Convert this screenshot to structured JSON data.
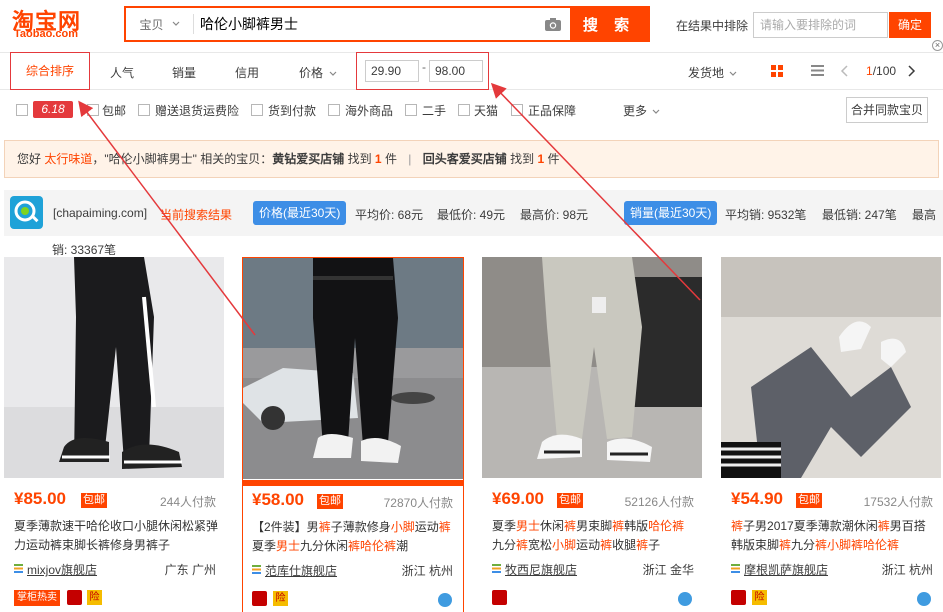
{
  "header": {
    "logo_cn": "淘宝网",
    "logo_en": "Taobao.com",
    "search_category": "宝贝",
    "search_query": "哈伦小脚裤男士",
    "search_button": "搜 索",
    "exclude_label": "在结果中排除",
    "exclude_placeholder": "请输入要排除的词",
    "exclude_confirm": "确定",
    "accent_color": "#ff4400"
  },
  "sortbar": {
    "tabs": [
      "综合排序",
      "人气",
      "销量",
      "信用",
      "价格"
    ],
    "active_tab": "综合排序",
    "price_min": "29.90",
    "price_sep": "-",
    "price_max": "98.00",
    "ship_from": "发货地",
    "pager_current": "1",
    "pager_total": "/100"
  },
  "filters": {
    "badge_618": "6.18",
    "items": [
      "包邮",
      "赠送退货运费险",
      "货到付款",
      "海外商品",
      "二手",
      "天猫",
      "正品保障"
    ],
    "more": "更多",
    "merge_button": "合并同款宝贝"
  },
  "notice": {
    "prefix": "您好",
    "user": "太行味道",
    "mid1": "，\"哈伦小脚裤男士\" 相关的宝贝：",
    "shop1": "黄钻爱买店铺",
    "found1a": " 找到 ",
    "count1": "1",
    "found1b": " 件",
    "sep": "|",
    "shop2": "回头客爱买店铺",
    "found2a": " 找到 ",
    "count2": "1",
    "found2b": " 件"
  },
  "chapaiming": {
    "site": "[chapaiming.com]",
    "current": "当前搜索结果",
    "price_pill": "价格(最近30天)",
    "avg_price": "平均价: 68元",
    "min_price": "最低价: 49元",
    "max_price": "最高价: 98元",
    "sales_pill": "销量(最近30天)",
    "avg_sales": "平均销: 9532笔",
    "min_sales": "最低销: 247笔",
    "max_sales_cut": "最高",
    "max_sales_line": "销: 33367笔"
  },
  "products": [
    {
      "price": "¥85.00",
      "baoyou": "包邮",
      "paid": "244人付款",
      "title_parts": [
        "夏季薄款速干哈伦收口小腿休闲松紧弹力运动裤束脚长裤修身男裤子"
      ],
      "shop": "mixjov旗舰店",
      "location": "广东 广州",
      "badge": "掌柜热卖"
    },
    {
      "price": "¥58.00",
      "baoyou": "包邮",
      "paid": "72870人付款",
      "title_line1": "【2件装】男",
      "title_line1b": "裤",
      "title_line1c": "子薄款修身",
      "title_line1d": "小脚",
      "title_line1e": "运动",
      "title_line1f": "裤",
      "title_line2a": "夏季",
      "title_line2b": "男士",
      "title_line2c": "九分休闲",
      "title_line2d": "裤哈伦裤",
      "title_line2e": "潮",
      "shop": "范库仕旗舰店",
      "location": "浙江 杭州"
    },
    {
      "price": "¥69.00",
      "baoyou": "包邮",
      "paid": "52126人付款",
      "title_line1a": "夏季",
      "title_line1b": "男士",
      "title_line1c": "休闲",
      "title_line1d": "裤",
      "title_line1e": "男束脚",
      "title_line1f": "裤",
      "title_line1g": "韩版",
      "title_line1h": "哈伦裤",
      "title_line2a": "九分",
      "title_line2b": "裤",
      "title_line2c": "宽松",
      "title_line2d": "小脚",
      "title_line2e": "运动",
      "title_line2f": "裤",
      "title_line2g": "收腿",
      "title_line2h": "裤",
      "title_line2i": "子",
      "shop": "牧西尼旗舰店",
      "location": "浙江 金华"
    },
    {
      "price": "¥54.90",
      "baoyou": "包邮",
      "paid": "17532人付款",
      "title_line1a": "裤",
      "title_line1b": "子男2017夏季薄款潮休闲",
      "title_line1c": "裤",
      "title_line1d": "男百搭",
      "title_line2a": "韩版束脚",
      "title_line2b": "裤",
      "title_line2c": "九分",
      "title_line2d": "裤小脚裤哈伦裤",
      "shop": "摩根凯萨旗舰店",
      "location": "浙江 杭州"
    }
  ]
}
